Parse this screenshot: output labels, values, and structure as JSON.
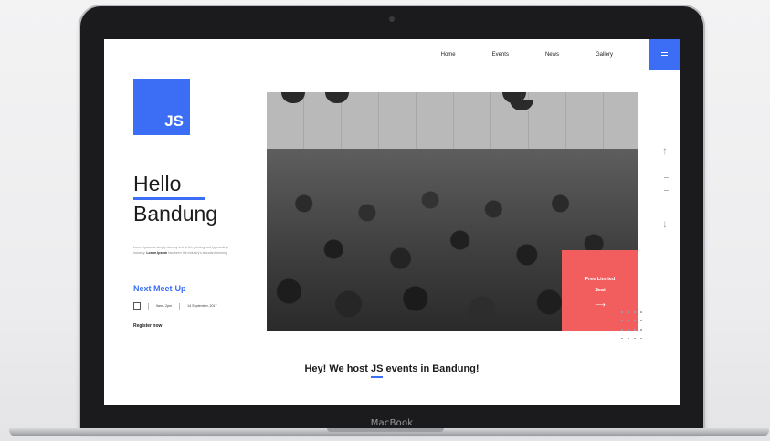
{
  "device": {
    "brand": "MacBook"
  },
  "nav": {
    "items": [
      "Home",
      "Events",
      "News",
      "Gallery"
    ],
    "menu_icon": "hamburger-icon"
  },
  "hero": {
    "logo_text": "JS",
    "greeting_line1": "Hello",
    "greeting_line2": "Bandung",
    "description": "Lorem Ipsum is simply dummy text of the printing and typesetting industry.",
    "description_bold": "Lorem Ipsum",
    "description_tail": "has been the industry's standard dummy.",
    "meetup_title": "Next Meet-Up",
    "meetup_time": "9am - 2pm",
    "meetup_date": "14 September, 2017",
    "register_label": "Register now"
  },
  "promo": {
    "line1": "Free Limited",
    "line2": "Seat",
    "arrow": "⟶"
  },
  "side_controls": {
    "up_icon": "↑",
    "down_icon": "↓"
  },
  "tagline": {
    "before": "Hey! We host ",
    "highlight": "JS",
    "after": " events in Bandung!"
  },
  "colors": {
    "accent_blue": "#3b6ef5",
    "promo_red": "#f25d5d"
  }
}
